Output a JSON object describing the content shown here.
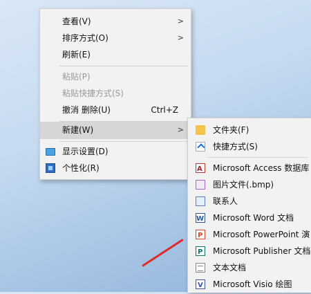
{
  "context_menu": {
    "items": [
      {
        "label": "查看(V)",
        "has_submenu": true
      },
      {
        "label": "排序方式(O)",
        "has_submenu": true
      },
      {
        "label": "刷新(E)"
      },
      {
        "label": "粘贴(P)",
        "disabled": true
      },
      {
        "label": "粘贴快捷方式(S)",
        "disabled": true
      },
      {
        "label": "撤消 删除(U)",
        "shortcut": "Ctrl+Z"
      },
      {
        "label": "新建(W)",
        "has_submenu": true,
        "highlighted": true
      },
      {
        "label": "显示设置(D)",
        "icon": "display-icon"
      },
      {
        "label": "个性化(R)",
        "icon": "personalize-icon"
      }
    ]
  },
  "new_submenu": {
    "items": [
      {
        "label": "文件夹(F)",
        "icon": "folder-icon"
      },
      {
        "label": "快捷方式(S)",
        "icon": "shortcut-icon"
      },
      {
        "label": "Microsoft Access 数据库",
        "icon": "access-icon"
      },
      {
        "label": "图片文件(.bmp)",
        "icon": "bitmap-icon"
      },
      {
        "label": "联系人",
        "icon": "contact-icon"
      },
      {
        "label": "Microsoft Word 文档",
        "icon": "word-icon"
      },
      {
        "label": "Microsoft PowerPoint 演",
        "icon": "powerpoint-icon"
      },
      {
        "label": "Microsoft Publisher 文档",
        "icon": "publisher-icon"
      },
      {
        "label": "文本文档",
        "icon": "text-document-icon"
      },
      {
        "label": "Microsoft Visio 绘图",
        "icon": "visio-icon"
      }
    ]
  },
  "colors": {
    "menu_background": "#f2f2f2",
    "highlight": "#d6d6d6",
    "disabled_text": "#9a9a9a",
    "annotation_arrow": "#e02a2a"
  }
}
